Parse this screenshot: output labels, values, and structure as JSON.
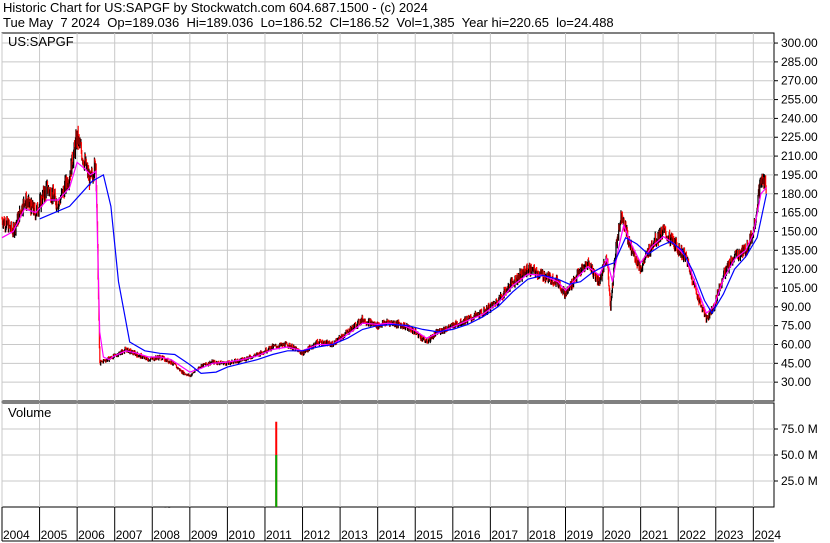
{
  "header": {
    "line1": "Historic Chart for US:SAPGF by Stockwatch.com 604.687.1500 - (c) 2024",
    "line2": "Tue May  7 2024  Op=189.036  Hi=189.036  Lo=186.52  Cl=186.52  Vol=1,385  Year hi=220.65  lo=24.488"
  },
  "colors": {
    "background": "#ffffff",
    "grid": "#c8c8c8",
    "price_bar_up": "#000000",
    "price_bar_down": "#ff0000",
    "ma_short": "#ff00ff",
    "ma_long": "#0000ff",
    "volume_up": "#00aa00",
    "volume_down": "#ff0000"
  },
  "chart_data": [
    {
      "type": "line",
      "title": "US:SAPGF",
      "ylim": [
        15,
        308
      ],
      "yticks": [
        30,
        45,
        60,
        75,
        90,
        105,
        120,
        135,
        150,
        165,
        180,
        195,
        210,
        225,
        240,
        255,
        270,
        285,
        300
      ],
      "ytick_labels": [
        "30.00",
        "45.00",
        "60.00",
        "75.00",
        "90.00",
        "105.00",
        "120.00",
        "135.00",
        "150.00",
        "165.00",
        "180.00",
        "195.00",
        "210.00",
        "225.00",
        "240.00",
        "255.00",
        "270.00",
        "285.00",
        "300.00"
      ],
      "xlim": [
        2004,
        2024.55
      ],
      "xticks": [
        2004,
        2005,
        2006,
        2007,
        2008,
        2009,
        2010,
        2011,
        2012,
        2013,
        2014,
        2015,
        2016,
        2017,
        2018,
        2019,
        2020,
        2021,
        2022,
        2023,
        2024
      ],
      "xtick_labels": [
        "2004",
        "2005",
        "2006",
        "2007",
        "2008",
        "2009",
        "2010",
        "2011",
        "2012",
        "2013",
        "2014",
        "2015",
        "2016",
        "2017",
        "2018",
        "2019",
        "2020",
        "2021",
        "2022",
        "2023",
        "2024"
      ],
      "grid": true,
      "series": [
        {
          "role": "price",
          "x": [
            2004.0,
            2004.3,
            2004.6,
            2004.9,
            2005.2,
            2005.5,
            2005.8,
            2006.0,
            2006.2,
            2006.35,
            2006.5,
            2006.6,
            2006.7,
            2006.8,
            2006.95,
            2007.3,
            2007.6,
            2007.9,
            2008.2,
            2008.5,
            2008.8,
            2009.0,
            2009.3,
            2009.6,
            2010.0,
            2010.4,
            2010.8,
            2011.2,
            2011.6,
            2012.0,
            2012.4,
            2012.8,
            2013.2,
            2013.6,
            2014.0,
            2014.3,
            2014.7,
            2015.0,
            2015.3,
            2015.6,
            2016.0,
            2016.4,
            2016.8,
            2017.2,
            2017.6,
            2018.0,
            2018.4,
            2018.8,
            2019.0,
            2019.3,
            2019.6,
            2019.9,
            2020.1,
            2020.2,
            2020.35,
            2020.5,
            2020.7,
            2021.0,
            2021.3,
            2021.6,
            2021.9,
            2022.2,
            2022.5,
            2022.75,
            2022.95,
            2023.2,
            2023.5,
            2023.8,
            2024.0,
            2024.2,
            2024.35
          ],
          "values": [
            160,
            150,
            175,
            165,
            185,
            172,
            195,
            225,
            205,
            190,
            205,
            45,
            47,
            48,
            50,
            56,
            52,
            48,
            50,
            46,
            38,
            35,
            43,
            46,
            45,
            48,
            52,
            58,
            60,
            53,
            62,
            60,
            70,
            80,
            75,
            78,
            75,
            70,
            62,
            70,
            75,
            80,
            85,
            95,
            110,
            120,
            115,
            110,
            100,
            115,
            125,
            110,
            130,
            90,
            140,
            165,
            140,
            120,
            140,
            150,
            140,
            130,
            100,
            80,
            90,
            115,
            130,
            135,
            150,
            190,
            188
          ]
        },
        {
          "role": "short-ma",
          "x": [
            2004.0,
            2004.3,
            2004.6,
            2004.9,
            2005.2,
            2005.5,
            2005.8,
            2006.0,
            2006.2,
            2006.35,
            2006.5,
            2006.6,
            2006.7,
            2006.85,
            2007.0,
            2007.3,
            2007.6,
            2007.9,
            2008.2,
            2008.5,
            2008.8,
            2009.0,
            2009.3,
            2009.6,
            2010.0,
            2010.4,
            2010.8,
            2011.2,
            2011.6,
            2012.0,
            2012.4,
            2012.8,
            2013.2,
            2013.6,
            2014.0,
            2014.3,
            2014.7,
            2015.0,
            2015.3,
            2015.6,
            2016.0,
            2016.4,
            2016.8,
            2017.2,
            2017.6,
            2018.0,
            2018.4,
            2018.8,
            2019.0,
            2019.3,
            2019.6,
            2019.9,
            2020.1,
            2020.25,
            2020.4,
            2020.55,
            2020.75,
            2021.0,
            2021.3,
            2021.6,
            2021.9,
            2022.2,
            2022.5,
            2022.75,
            2022.95,
            2023.2,
            2023.5,
            2023.8,
            2024.0,
            2024.2,
            2024.35
          ],
          "values": [
            145,
            150,
            168,
            165,
            175,
            175,
            185,
            205,
            200,
            195,
            198,
            70,
            50,
            48,
            51,
            55,
            53,
            50,
            50,
            48,
            42,
            38,
            41,
            45,
            46,
            48,
            51,
            56,
            58,
            55,
            60,
            60,
            68,
            77,
            76,
            77,
            75,
            71,
            65,
            69,
            74,
            79,
            84,
            93,
            107,
            116,
            115,
            110,
            103,
            113,
            122,
            115,
            128,
            110,
            135,
            155,
            140,
            125,
            138,
            146,
            140,
            130,
            105,
            85,
            90,
            112,
            128,
            135,
            148,
            180,
            185
          ]
        },
        {
          "role": "long-ma",
          "x": [
            2005.0,
            2005.4,
            2005.8,
            2006.1,
            2006.4,
            2006.7,
            2006.9,
            2007.1,
            2007.4,
            2007.8,
            2008.2,
            2008.6,
            2009.0,
            2009.3,
            2009.7,
            2010.0,
            2010.4,
            2010.8,
            2011.2,
            2011.6,
            2012.0,
            2012.4,
            2012.8,
            2013.2,
            2013.6,
            2014.0,
            2014.4,
            2014.8,
            2015.2,
            2015.6,
            2016.0,
            2016.4,
            2016.8,
            2017.2,
            2017.6,
            2018.0,
            2018.4,
            2018.8,
            2019.1,
            2019.4,
            2019.7,
            2020.0,
            2020.3,
            2020.6,
            2020.9,
            2021.2,
            2021.5,
            2021.8,
            2022.1,
            2022.4,
            2022.7,
            2022.9,
            2023.2,
            2023.5,
            2023.8,
            2024.1,
            2024.35
          ],
          "values": [
            160,
            165,
            170,
            180,
            190,
            195,
            170,
            110,
            62,
            55,
            53,
            52,
            44,
            37,
            38,
            42,
            45,
            48,
            52,
            55,
            55,
            58,
            60,
            65,
            72,
            75,
            76,
            75,
            72,
            70,
            72,
            76,
            82,
            90,
            102,
            112,
            115,
            112,
            108,
            110,
            117,
            122,
            125,
            145,
            140,
            132,
            138,
            142,
            135,
            118,
            95,
            85,
            100,
            120,
            130,
            145,
            180
          ]
        }
      ]
    },
    {
      "type": "bar",
      "title": "Volume",
      "ylim": [
        0,
        100
      ],
      "yticks": [
        25,
        50,
        75
      ],
      "ytick_labels": [
        "25.0 M",
        "50.0 M",
        "75.0 M"
      ],
      "x": [
        2008.35,
        2008.45,
        2011.3,
        2011.3,
        2015.1
      ],
      "values": [
        0.4,
        0.3,
        82,
        50,
        0.4
      ],
      "bar_colors": [
        "#000000",
        "#000000",
        "#ff0000",
        "#00aa00",
        "#000000"
      ]
    }
  ]
}
